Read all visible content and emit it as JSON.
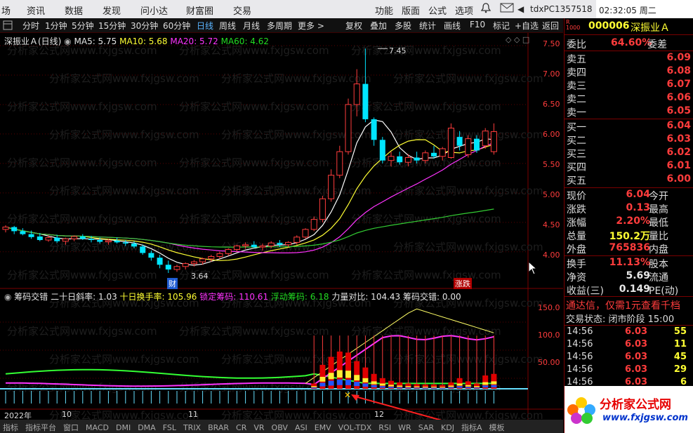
{
  "menubar": {
    "items": [
      "场",
      "资讯",
      "数据",
      "发现",
      "问小达",
      "财富圈",
      "交易"
    ],
    "right_items": [
      "功能",
      "版面",
      "公式",
      "选项"
    ],
    "bell_icon": "bell-icon",
    "host": "tdxPC1357518",
    "clock": "02:32:05 周二"
  },
  "toolbar": {
    "periods": [
      "分时",
      "1分钟",
      "5分钟",
      "15分钟",
      "30分钟",
      "60分钟",
      "日线",
      "周线",
      "月线",
      "多周期",
      "更多 >"
    ],
    "active_period": "日线",
    "tools": [
      "复权",
      "叠加",
      "多股",
      "统计",
      "画线",
      "F10",
      "标记",
      "+自选",
      "返回"
    ]
  },
  "chart_header": {
    "stock": "深振业Ａ(日线)",
    "ma5": "MA5: 5.75",
    "ma10": "MA10: 5.68",
    "ma20": "MA20: 5.72",
    "ma60": "MA60: 4.62",
    "high_label": "7.45",
    "low_label": "3.64",
    "fin_badge": "财",
    "limit_badge": "涨跌",
    "watermark": "分析家公式网www.fxjgsw.com"
  },
  "indicator_header": {
    "name": "筹码交错",
    "slope": "二十日斜率: 1.03",
    "turnover": "十日换手率: 105.96",
    "lock": "锁定筹码: 110.61",
    "float": "浮动筹码: 6.18",
    "power": "力量对比: 104.43",
    "cross": "筹码交错: 0.00"
  },
  "axis": {
    "price_ticks": [
      "7.50",
      "7.00",
      "6.50",
      "6.00",
      "5.50",
      "5.00",
      "4.50",
      "4.00"
    ],
    "ind_ticks": [
      "150.0",
      "100.0",
      "50.00"
    ],
    "date_labels": [
      "2022年",
      "10",
      "11",
      "12"
    ]
  },
  "quote": {
    "code": "000006",
    "name": "深振业Ａ",
    "weibi_label": "委比",
    "weibi": "64.60%",
    "weicha": "委差",
    "asks": [
      {
        "label": "卖五",
        "price": "6.09"
      },
      {
        "label": "卖四",
        "price": "6.08"
      },
      {
        "label": "卖三",
        "price": "6.07"
      },
      {
        "label": "卖二",
        "price": "6.06"
      },
      {
        "label": "卖一",
        "price": "6.05"
      }
    ],
    "bids": [
      {
        "label": "买一",
        "price": "6.04"
      },
      {
        "label": "买二",
        "price": "6.03"
      },
      {
        "label": "买三",
        "price": "6.02"
      },
      {
        "label": "买四",
        "price": "6.01"
      },
      {
        "label": "买五",
        "price": "6.00"
      }
    ],
    "stats": [
      {
        "label": "现价",
        "value": "6.04",
        "right": "今开"
      },
      {
        "label": "涨跌",
        "value": "0.13",
        "right": "最高"
      },
      {
        "label": "涨幅",
        "value": "2.20%",
        "right": "最低"
      },
      {
        "label": "总量",
        "value": "150.2万",
        "right": "量比"
      },
      {
        "label": "外盘",
        "value": "765836",
        "right": "内盘"
      }
    ],
    "stats2": [
      {
        "label": "换手",
        "value": "11.13%",
        "right": "股本"
      },
      {
        "label": "净资",
        "value": "5.69",
        "right": "流通"
      },
      {
        "label": "收益(三)",
        "value": "0.149",
        "right": "PE(动)"
      }
    ],
    "promo": "通达信，仅需1元查看千档",
    "trade_state": "交易状态: 闭市阶段 15:00",
    "ticks": [
      {
        "time": "14:56",
        "price": "6.03",
        "vol": "55"
      },
      {
        "time": "14:56",
        "price": "6.03",
        "vol": "11"
      },
      {
        "time": "14:56",
        "price": "6.03",
        "vol": "45"
      },
      {
        "time": "14:56",
        "price": "6.03",
        "vol": "29"
      },
      {
        "time": "14:56",
        "price": "6.03",
        "vol": "6"
      }
    ],
    "logo_text": "分析家公式网",
    "logo_url": "www.fxjgsw.com"
  },
  "footer": {
    "items": [
      "指标",
      "指标平台",
      "窗口",
      "MACD",
      "DMI",
      "DMA",
      "FSL",
      "TRIX",
      "BRAR",
      "CR",
      "VR",
      "OBV",
      "ASI",
      "EMV",
      "VOL-TDX",
      "RSI",
      "WR",
      "SAR",
      "KDJ",
      "指标A",
      "模板"
    ]
  },
  "colors": {
    "up": "#ff3c3c",
    "down": "#00e5ff",
    "ma5": "#ffffff",
    "ma10": "#ffff33",
    "ma20": "#ff33ff",
    "ma60": "#33cc33"
  },
  "chart_data": {
    "type": "candlestick",
    "price_ylim": [
      3.6,
      7.6
    ],
    "candles": [
      [
        4.38,
        4.45,
        4.33,
        4.42
      ],
      [
        4.42,
        4.44,
        4.3,
        4.35
      ],
      [
        4.35,
        4.4,
        4.28,
        4.3
      ],
      [
        4.3,
        4.36,
        4.22,
        4.25
      ],
      [
        4.26,
        4.32,
        4.18,
        4.2
      ],
      [
        4.2,
        4.28,
        4.17,
        4.24
      ],
      [
        4.24,
        4.29,
        4.15,
        4.18
      ],
      [
        4.18,
        4.24,
        4.12,
        4.22
      ],
      [
        4.22,
        4.28,
        4.18,
        4.26
      ],
      [
        4.26,
        4.3,
        4.2,
        4.22
      ],
      [
        4.22,
        4.27,
        4.16,
        4.2
      ],
      [
        4.2,
        4.24,
        4.14,
        4.17
      ],
      [
        4.17,
        4.22,
        4.12,
        4.19
      ],
      [
        4.19,
        4.24,
        4.14,
        4.16
      ],
      [
        4.16,
        4.2,
        4.1,
        4.14
      ],
      [
        4.14,
        4.18,
        4.06,
        4.09
      ],
      [
        4.09,
        4.12,
        3.95,
        3.98
      ],
      [
        3.98,
        4.02,
        3.85,
        3.9
      ],
      [
        3.9,
        3.95,
        3.72,
        3.78
      ],
      [
        3.78,
        3.85,
        3.64,
        3.7
      ],
      [
        3.7,
        3.78,
        3.66,
        3.75
      ],
      [
        3.75,
        3.82,
        3.7,
        3.8
      ],
      [
        3.8,
        3.86,
        3.75,
        3.83
      ],
      [
        3.83,
        3.9,
        3.78,
        3.88
      ],
      [
        3.88,
        3.95,
        3.83,
        3.92
      ],
      [
        3.92,
        4.0,
        3.88,
        3.97
      ],
      [
        3.97,
        4.06,
        3.93,
        4.04
      ],
      [
        4.04,
        4.12,
        4.0,
        4.1
      ],
      [
        4.1,
        4.16,
        4.05,
        4.12
      ],
      [
        4.12,
        4.18,
        4.06,
        4.08
      ],
      [
        4.08,
        4.14,
        4.02,
        4.1
      ],
      [
        4.1,
        4.18,
        4.06,
        4.15
      ],
      [
        4.15,
        4.2,
        4.08,
        4.12
      ],
      [
        4.12,
        4.18,
        4.08,
        4.16
      ],
      [
        4.16,
        4.28,
        4.12,
        4.25
      ],
      [
        4.25,
        4.4,
        4.22,
        4.38
      ],
      [
        4.38,
        4.6,
        4.35,
        4.55
      ],
      [
        4.55,
        4.95,
        4.5,
        4.9
      ],
      [
        4.9,
        5.4,
        4.85,
        5.3
      ],
      [
        5.3,
        5.8,
        5.25,
        5.7
      ],
      [
        5.7,
        6.6,
        5.65,
        6.5
      ],
      [
        6.5,
        7.1,
        6.3,
        6.85
      ],
      [
        6.85,
        7.45,
        6.2,
        6.25
      ],
      [
        6.25,
        6.28,
        5.8,
        5.9
      ],
      [
        5.9,
        5.95,
        5.5,
        5.55
      ],
      [
        5.55,
        5.7,
        5.45,
        5.62
      ],
      [
        5.62,
        5.7,
        5.48,
        5.52
      ],
      [
        5.52,
        5.66,
        5.45,
        5.6
      ],
      [
        5.6,
        5.7,
        5.5,
        5.55
      ],
      [
        5.55,
        5.72,
        5.5,
        5.68
      ],
      [
        5.68,
        5.8,
        5.58,
        5.62
      ],
      [
        5.62,
        5.78,
        5.55,
        5.75
      ],
      [
        5.6,
        6.18,
        5.58,
        6.1
      ],
      [
        5.95,
        6.05,
        5.72,
        5.8
      ],
      [
        5.65,
        5.98,
        5.6,
        5.92
      ],
      [
        5.92,
        5.98,
        5.68,
        5.72
      ],
      [
        5.8,
        6.1,
        5.75,
        6.05
      ],
      [
        5.7,
        6.18,
        5.65,
        6.04
      ]
    ],
    "indicator_ylim": [
      0,
      170
    ],
    "ind_bars": [
      0,
      0,
      0,
      0,
      0,
      0,
      0,
      0,
      0,
      0,
      0,
      0,
      0,
      0,
      0,
      0,
      0,
      0,
      0,
      0,
      0,
      0,
      0,
      0,
      0,
      0,
      0,
      0,
      0,
      0,
      0,
      0,
      0,
      0,
      0,
      0,
      10,
      45,
      60,
      70,
      68,
      52,
      40,
      28,
      20,
      15,
      12,
      10,
      9,
      8,
      8,
      7,
      12,
      20,
      14,
      10,
      25,
      28
    ]
  }
}
